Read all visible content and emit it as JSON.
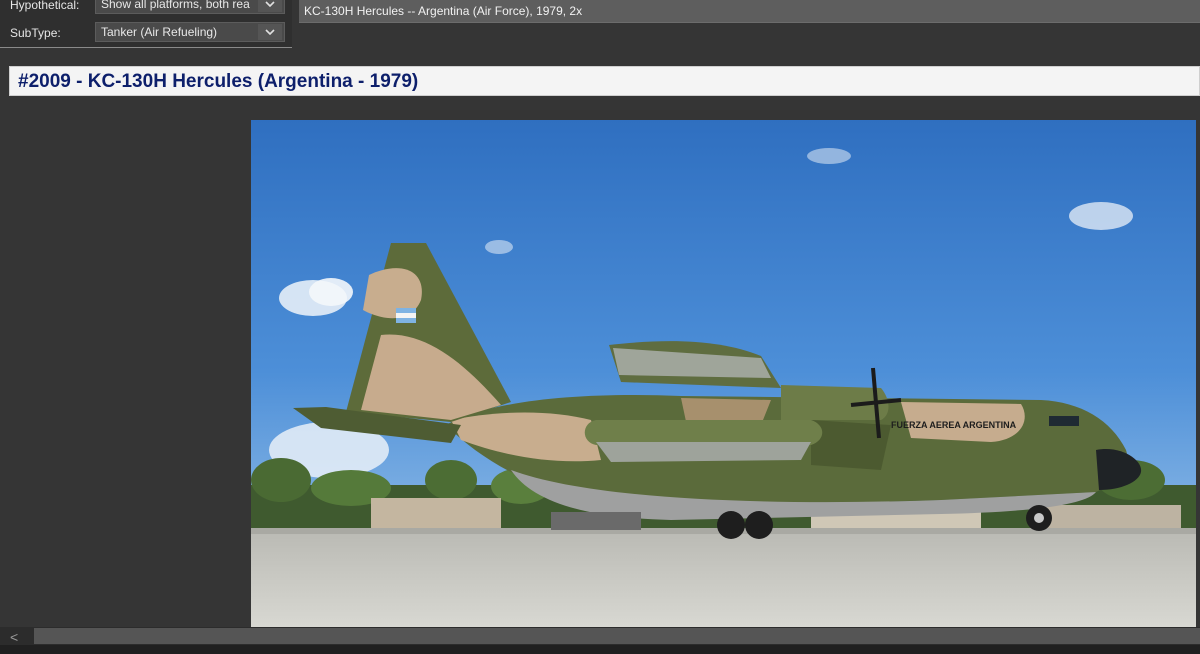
{
  "filters": {
    "hypothetical": {
      "label": "Hypothetical:",
      "value": "Show all platforms, both rea"
    },
    "subtype": {
      "label": "SubType:",
      "value": "Tanker (Air Refueling)"
    }
  },
  "selected_item": "KC-130H Hercules -- Argentina (Air Force), 1979, 2x",
  "heading": "#2009 - KC-130H Hercules (Argentina - 1979)",
  "photo": {
    "fuselage_text": "FUERZA AEREA ARGENTINA"
  },
  "scrollbar": {
    "left_arrow": "<"
  },
  "colors": {
    "background": "#353535",
    "heading_text": "#0d1f6b",
    "heading_bg": "#f4f4f4",
    "sky": "#3b78c4",
    "tarmac": "#c9c9c4"
  },
  "icons": [
    "chevron-down-icon",
    "chevron-left-icon"
  ]
}
